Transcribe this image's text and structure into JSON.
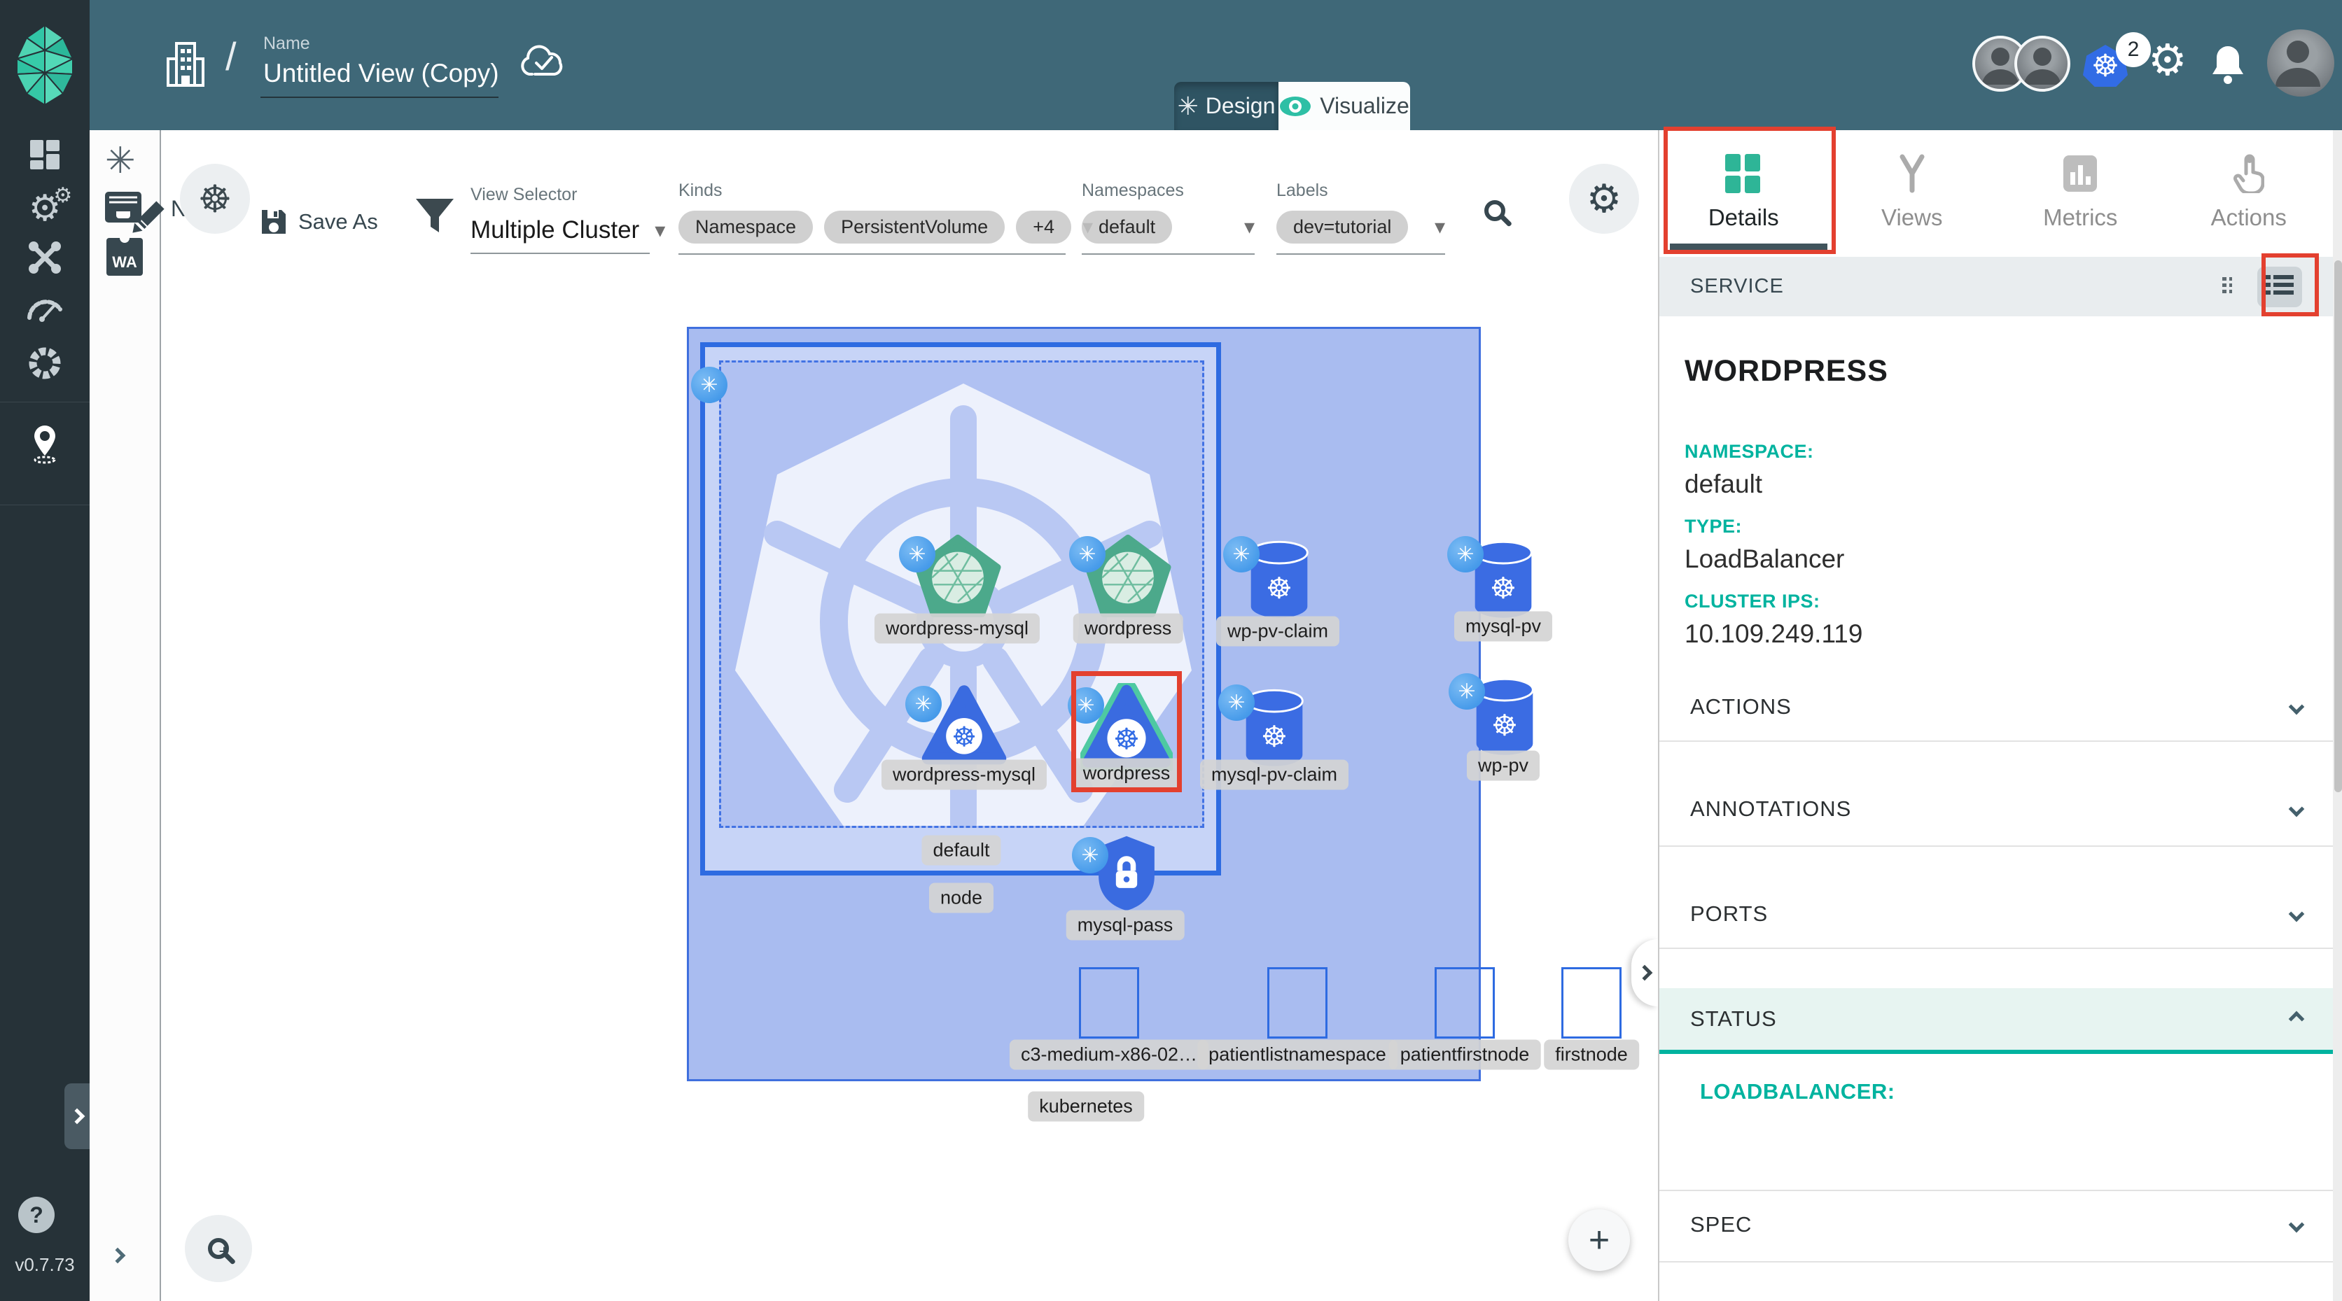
{
  "header": {
    "name_label": "Name",
    "name_value": "Untitled View (Copy)",
    "slash": "/",
    "design_tab": "Design",
    "visualize_tab": "Visualize",
    "k8s_badge_count": "2"
  },
  "sidebar": {
    "version": "v0.7.73",
    "help": "?"
  },
  "toolbar": {
    "hidden_name": "N",
    "save_as": "Save As",
    "view_selector": {
      "label": "View Selector",
      "value": "Multiple Cluster"
    },
    "kinds": {
      "label": "Kinds",
      "chips": [
        "Namespace",
        "PersistentVolume",
        "+4"
      ]
    },
    "namespaces": {
      "label": "Namespaces",
      "value": "default"
    },
    "labels_filter": {
      "label": "Labels",
      "value": "dev=tutorial"
    }
  },
  "canvas": {
    "cluster_label": "kubernetes",
    "node_label": "node",
    "namespace_label": "default",
    "deployments": [
      {
        "label": "wordpress-mysql"
      },
      {
        "label": "wordpress"
      }
    ],
    "services": [
      {
        "label": "wordpress-mysql",
        "selected": false
      },
      {
        "label": "wordpress",
        "selected": true
      }
    ],
    "pvcs": [
      {
        "label": "wp-pv-claim"
      },
      {
        "label": "mysql-pv-claim"
      }
    ],
    "pvs": [
      {
        "label": "mysql-pv"
      },
      {
        "label": "wp-pv"
      }
    ],
    "secret": {
      "label": "mysql-pass"
    },
    "empty_nodes": [
      "c3-medium-x86-02…",
      "patientlistnamespace",
      "patientfirstnode",
      "firstnode"
    ]
  },
  "panel": {
    "tabs": [
      {
        "label": "Details"
      },
      {
        "label": "Views"
      },
      {
        "label": "Metrics"
      },
      {
        "label": "Actions"
      }
    ],
    "resource_kind": "SERVICE",
    "title": "WORDPRESS",
    "fields": [
      {
        "label": "NAMESPACE:",
        "value": "default"
      },
      {
        "label": "TYPE:",
        "value": "LoadBalancer"
      },
      {
        "label": "CLUSTER IPS:",
        "value": "10.109.249.119"
      }
    ],
    "sections": [
      "ACTIONS",
      "ANNOTATIONS",
      "PORTS",
      "STATUS"
    ],
    "status_content": "LOADBALANCER:",
    "spec_section": "SPEC"
  },
  "icons": {
    "k8s_wheel": "☸",
    "spiral": "✳",
    "gear": "⚙",
    "plus": "+",
    "caret_down": "▾"
  },
  "colors": {
    "accent": "#00B39F",
    "header": "#3F6878",
    "sidebar": "#263238",
    "k8s_blue": "#326CE5",
    "node_border": "#2E6BE1",
    "cluster_fill": "#A9BCF0",
    "annotation_red": "#E3402F"
  }
}
